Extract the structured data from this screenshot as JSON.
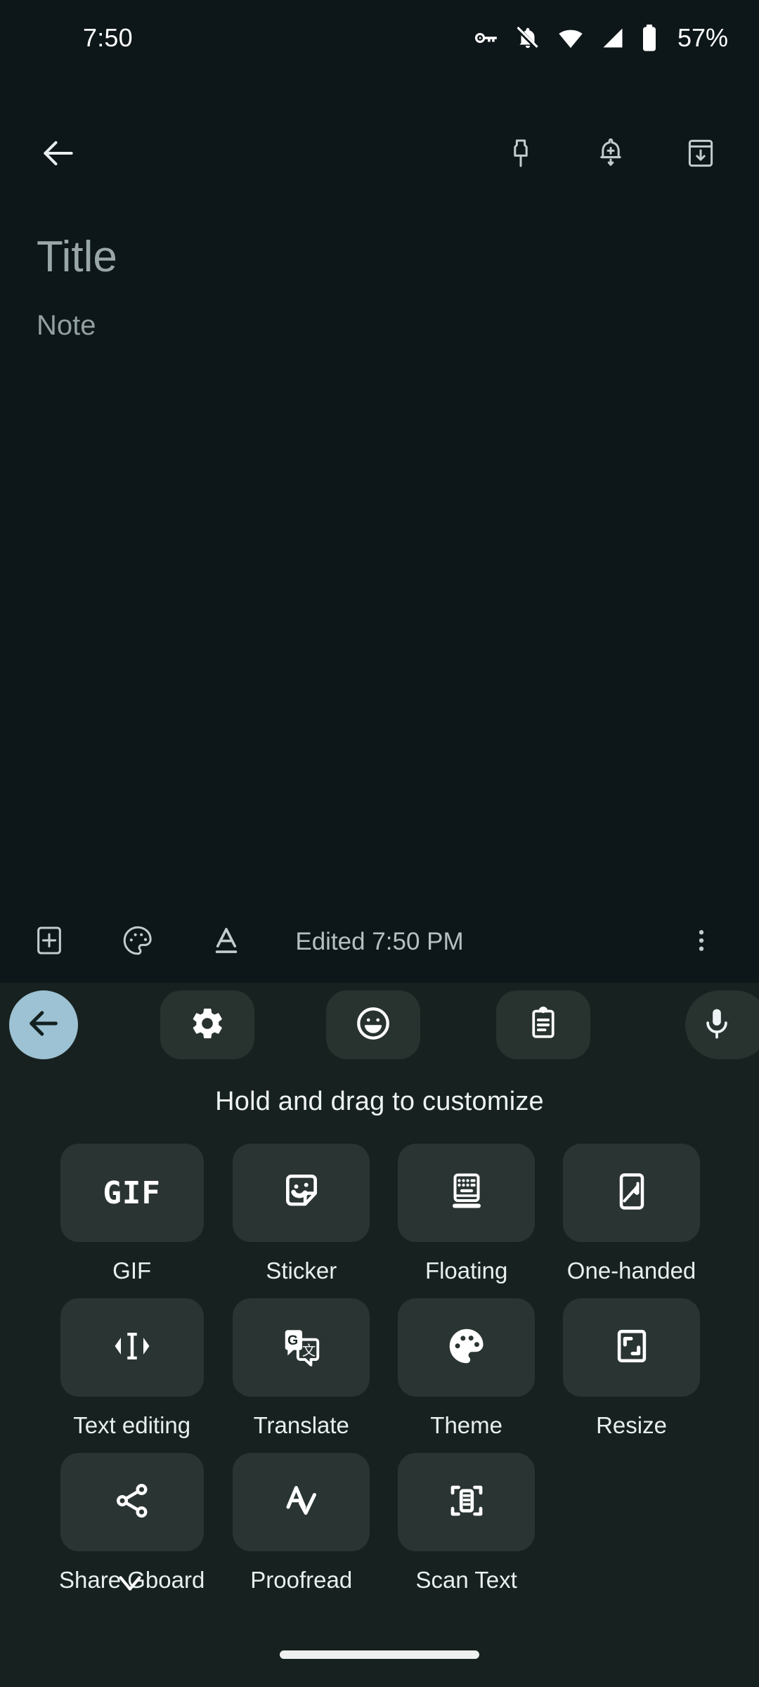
{
  "status_bar": {
    "clock": "7:50",
    "battery_percent": "57%",
    "icons": [
      "vpn-key-icon",
      "notifications-off-icon",
      "wifi-icon",
      "cellular-signal-icon",
      "battery-icon"
    ]
  },
  "app_bar": {
    "back_label": "back-arrow-icon",
    "actions": [
      {
        "name": "pin-icon",
        "label": "Pin note"
      },
      {
        "name": "reminder-add-icon",
        "label": "Add reminder"
      },
      {
        "name": "archive-icon",
        "label": "Archive"
      }
    ]
  },
  "note": {
    "title_placeholder": "Title",
    "body_placeholder": "Note",
    "title_value": "",
    "body_value": ""
  },
  "note_toolbar": {
    "add_label": "add-box-icon",
    "palette_label": "palette-icon",
    "format_label": "text-format-icon",
    "edited_text": "Edited 7:50 PM",
    "more_label": "more-vert-icon"
  },
  "keyboard": {
    "toolbar": [
      {
        "name": "kb-back-button",
        "icon": "arrow-back-icon",
        "accent": "#9cc2d3"
      },
      {
        "name": "kb-settings-button",
        "icon": "gear-icon"
      },
      {
        "name": "kb-emoji-button",
        "icon": "emoji-face-icon"
      },
      {
        "name": "kb-clipboard-button",
        "icon": "clipboard-icon"
      },
      {
        "name": "kb-mic-button",
        "icon": "microphone-icon"
      }
    ],
    "hint": "Hold and drag to customize",
    "items": [
      {
        "label": "GIF",
        "icon": "gif-icon"
      },
      {
        "label": "Sticker",
        "icon": "sticker-icon"
      },
      {
        "label": "Floating",
        "icon": "floating-keyboard-icon"
      },
      {
        "label": "One-handed",
        "icon": "one-handed-icon"
      },
      {
        "label": "Text editing",
        "icon": "text-editing-icon"
      },
      {
        "label": "Translate",
        "icon": "translate-icon"
      },
      {
        "label": "Theme",
        "icon": "palette-icon"
      },
      {
        "label": "Resize",
        "icon": "resize-icon"
      },
      {
        "label": "Share Gboard",
        "icon": "share-icon"
      },
      {
        "label": "Proofread",
        "icon": "proofread-icon"
      },
      {
        "label": "Scan Text",
        "icon": "scan-text-icon"
      }
    ],
    "dismiss_label": "chevron-down-icon"
  },
  "nav": {
    "home_indicator": "home-gesture-bar"
  },
  "colors": {
    "app_background": "#0d1618",
    "keyboard_background": "#17211f",
    "tile_background": "#2a3432",
    "pill_background": "#28322f",
    "accent_back": "#9cc2d3",
    "icon_white": "#ffffff",
    "placeholder_grey": "#9aa7a9"
  }
}
